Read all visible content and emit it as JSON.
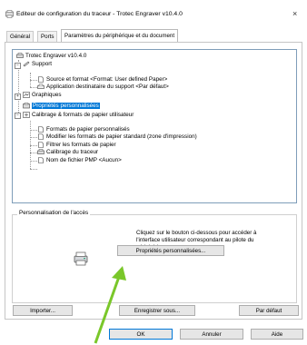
{
  "window": {
    "title": "Editeur de configuration du traceur - Trotec Engraver v10.4.0",
    "close_glyph": "×"
  },
  "tabs": [
    {
      "label": "Général"
    },
    {
      "label": "Ports"
    },
    {
      "label": "Paramètres du périphérique et du document"
    }
  ],
  "tree": {
    "items": [
      {
        "label": "Trotec Engraver v10.4.0"
      },
      {
        "label": "Support"
      },
      {
        "label": "Source et format <Format: User defined Paper>"
      },
      {
        "label": "Application destinataire du support <Par défaut>"
      },
      {
        "label": "Graphiques"
      },
      {
        "label": "Propriétés personnalisées"
      },
      {
        "label": "Calibrage & formats de papier utilisateur"
      },
      {
        "label": "Formats de papier personnalisés"
      },
      {
        "label": "Modifier les formats de papier standard (zone d'impression)"
      },
      {
        "label": "Filtrer les formats de papier"
      },
      {
        "label": "Calibrage du traceur"
      },
      {
        "label": "Nom de fichier PMP <Aucun>"
      }
    ],
    "expand_minus": "−",
    "expand_plus": "+"
  },
  "group": {
    "title": "Personnalisation de l'accès",
    "description": "Cliquez sur le bouton ci-dessous pour accéder à l'interface utilisateur correspondant au pilote du périphérique.",
    "custom_props_button": "Propriétés personnalisées..."
  },
  "buttons": {
    "import": "Importer...",
    "save_as": "Enregistrer sous...",
    "default": "Par défaut",
    "ok": "OK",
    "cancel": "Annuler",
    "help": "Aide"
  },
  "colors": {
    "selection": "#0078d7",
    "arrow": "#7ac72a"
  }
}
